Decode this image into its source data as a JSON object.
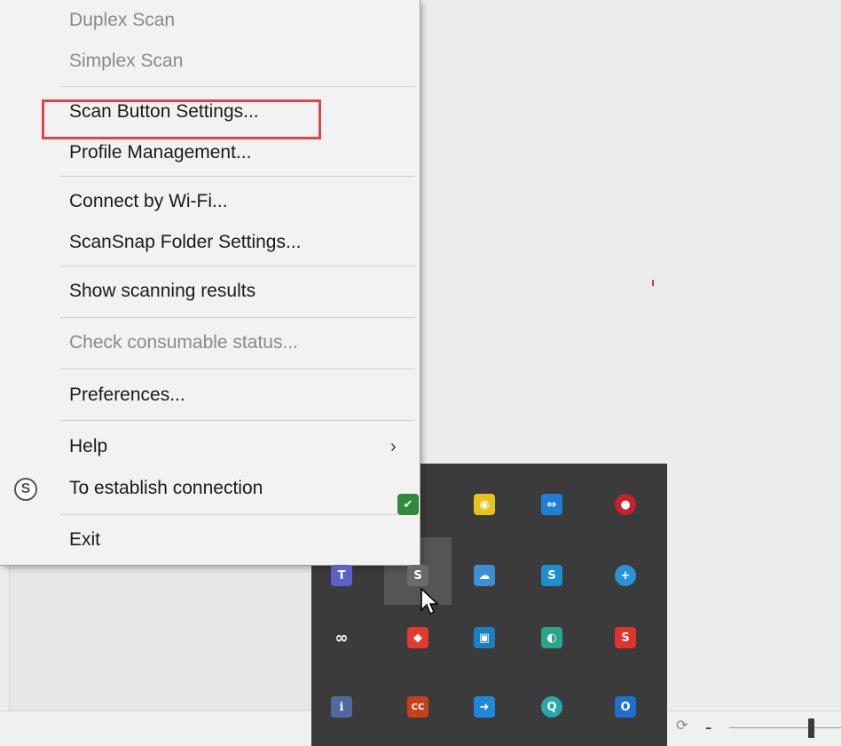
{
  "menu": {
    "items": [
      {
        "label": "Duplex Scan",
        "enabled": false
      },
      {
        "label": "Simplex Scan",
        "enabled": false
      },
      {
        "label": "Scan Button Settings...",
        "enabled": true,
        "highlighted": true
      },
      {
        "label": "Profile Management...",
        "enabled": true
      },
      {
        "label": "Connect by Wi-Fi...",
        "enabled": true
      },
      {
        "label": "ScanSnap Folder Settings...",
        "enabled": true
      },
      {
        "label": "Show scanning results",
        "enabled": true
      },
      {
        "label": "Check consumable status...",
        "enabled": false
      },
      {
        "label": "Preferences...",
        "enabled": true
      },
      {
        "label": "Help",
        "enabled": true,
        "submenu": true
      },
      {
        "label": "To establish connection",
        "enabled": true,
        "icon": "scansnap-icon"
      },
      {
        "label": "Exit",
        "enabled": true
      }
    ],
    "submenu_glyph": "›",
    "scansnap_glyph": "S"
  },
  "tray": {
    "icons": [
      {
        "name": "shield-check-icon",
        "glyph": "✔",
        "color": "#2e8b3e"
      },
      {
        "name": "wifi-signal-icon",
        "glyph": "◉",
        "color": "#e8c21a"
      },
      {
        "name": "teamviewer-icon",
        "glyph": "⇔",
        "color": "#1e7fd8"
      },
      {
        "name": "red-button-icon",
        "glyph": "●",
        "color": "#c8202a"
      },
      {
        "name": "teams-icon",
        "glyph": "T",
        "color": "#5a62c8"
      },
      {
        "name": "scansnap-tray-icon",
        "glyph": "S",
        "color": "#6a6a6a"
      },
      {
        "name": "cloud-globe-icon",
        "glyph": "☁",
        "color": "#3a8fd6"
      },
      {
        "name": "s-blue-icon",
        "glyph": "S",
        "color": "#1b8fd0"
      },
      {
        "name": "plus-circle-icon",
        "glyph": "+",
        "color": "#2a93d8"
      },
      {
        "name": "link-chain-icon",
        "glyph": "∞",
        "color": "#3b3b3b"
      },
      {
        "name": "red-diamond-icon",
        "glyph": "◆",
        "color": "#e33a2e"
      },
      {
        "name": "screen-share-icon",
        "glyph": "▣",
        "color": "#1d7fc2"
      },
      {
        "name": "green-blue-icon",
        "glyph": "◐",
        "color": "#2aa58a"
      },
      {
        "name": "s-red-icon",
        "glyph": "S",
        "color": "#e0332f"
      },
      {
        "name": "printer-info-icon",
        "glyph": "ℹ",
        "color": "#4f6b9e"
      },
      {
        "name": "cc4-icon",
        "glyph": "CC",
        "color": "#c8401a"
      },
      {
        "name": "arrow-share-icon",
        "glyph": "➜",
        "color": "#1e88d8"
      },
      {
        "name": "search-q-icon",
        "glyph": "Q",
        "color": "#2aa8a8"
      },
      {
        "name": "outlook-icon",
        "glyph": "O",
        "color": "#1f6fd0"
      }
    ]
  },
  "taskbar": {
    "zoom_minus": "-",
    "glyph": "⟳"
  }
}
